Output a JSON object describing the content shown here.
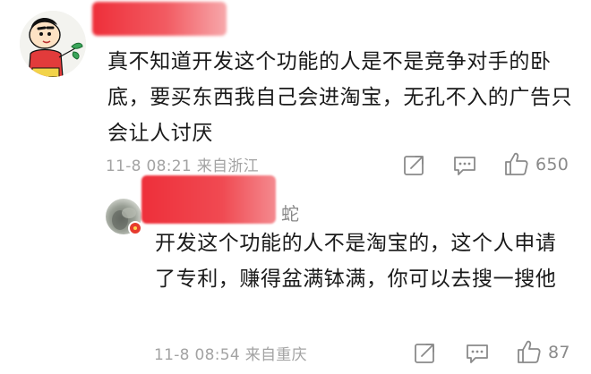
{
  "comments": [
    {
      "username_visible_tail": "",
      "text": "真不知道开发这个功能的人是不是竞争对手的卧底，要买东西我自己会进淘宝，无孔不入的广告只会让人讨厌",
      "time": "11-8 08:21",
      "location": "来自浙江",
      "like_count": "650",
      "avatar_icon": "cartoon-boy-avatar"
    },
    {
      "username_visible_tail": "蛇",
      "text": "开发这个功能的人不是淘宝的，这个人申请了专利，赚得盆满钵满，你可以去搜一搜他",
      "time": "11-8 08:54",
      "location": "来自重庆",
      "like_count": "87",
      "avatar_icon": "photo-avatar"
    }
  ],
  "colors": {
    "redaction": "#ee2f3a",
    "meta_text": "#a3a3a3",
    "icon": "#8a8a8a",
    "body_text": "#1a1a1a"
  },
  "icons": {
    "share": "share-icon",
    "comment": "comment-icon",
    "like": "thumbs-up-icon"
  }
}
